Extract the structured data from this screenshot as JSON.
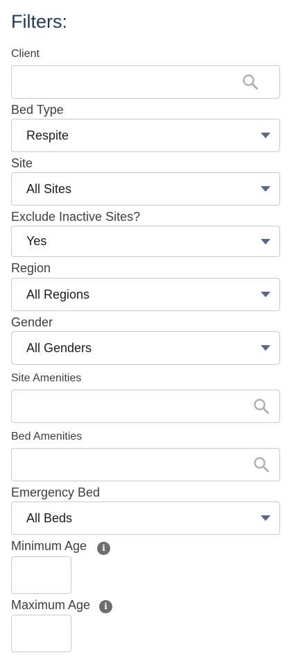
{
  "title": "Filters:",
  "fields": {
    "client": {
      "label": "Client",
      "value": ""
    },
    "bed_type": {
      "label": "Bed Type",
      "value": "Respite"
    },
    "site": {
      "label": "Site",
      "value": "All Sites"
    },
    "exclude_inactive": {
      "label": "Exclude Inactive Sites?",
      "value": "Yes"
    },
    "region": {
      "label": "Region",
      "value": "All Regions"
    },
    "gender": {
      "label": "Gender",
      "value": "All Genders"
    },
    "site_amenities": {
      "label": "Site Amenities",
      "value": ""
    },
    "bed_amenities": {
      "label": "Bed Amenities",
      "value": ""
    },
    "emergency_bed": {
      "label": "Emergency Bed",
      "value": "All Beds"
    },
    "min_age": {
      "label": "Minimum Age",
      "value": ""
    },
    "max_age": {
      "label": "Maximum Age",
      "value": ""
    }
  },
  "icons": {
    "search": "search-icon",
    "dropdown": "chevron-down-icon",
    "info": "info-icon",
    "info_glyph": "i"
  },
  "colors": {
    "title": "#1c3a63",
    "caret": "#54698d",
    "border": "#c9c9c9",
    "info_badge": "#706e6b"
  }
}
